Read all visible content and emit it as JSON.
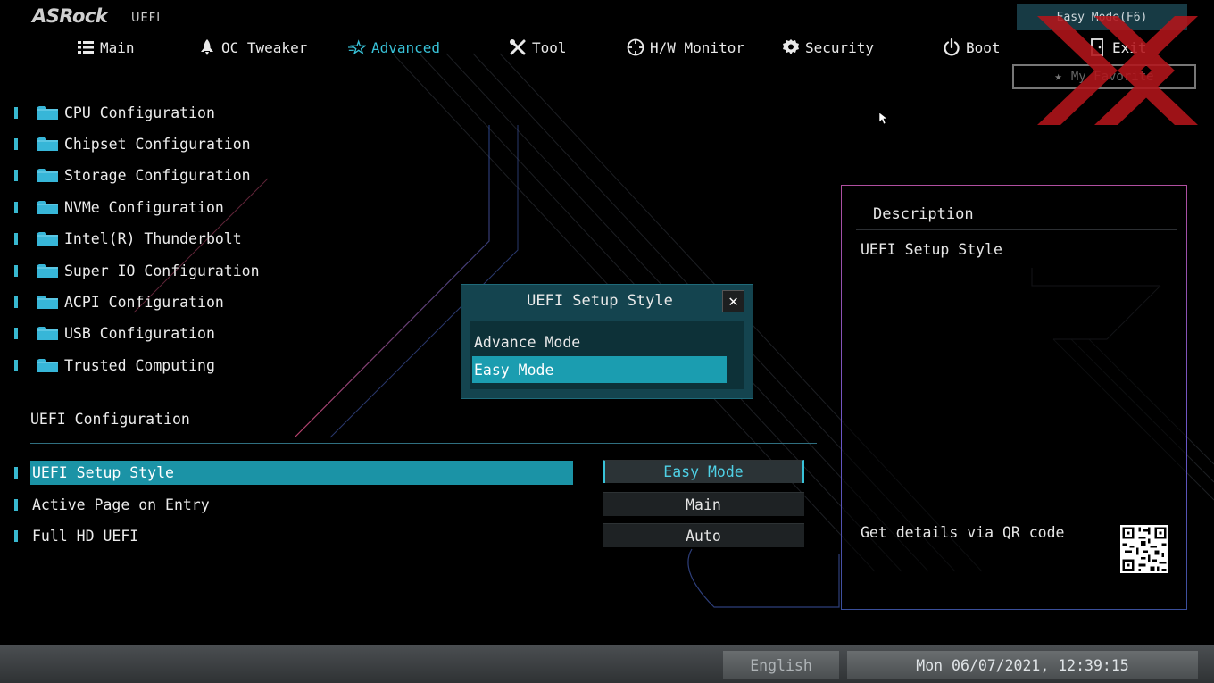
{
  "brand": {
    "logo": "ASRock",
    "suffix": "UEFI"
  },
  "nav": {
    "tabs": [
      {
        "label": "Main",
        "icon": "list-icon"
      },
      {
        "label": "OC Tweaker",
        "icon": "rocket-icon"
      },
      {
        "label": "Advanced",
        "icon": "star-icon",
        "active": true
      },
      {
        "label": "Tool",
        "icon": "tools-icon"
      },
      {
        "label": "H/W Monitor",
        "icon": "monitor-icon"
      },
      {
        "label": "Security",
        "icon": "shield-icon"
      },
      {
        "label": "Boot",
        "icon": "power-icon"
      },
      {
        "label": "Exit",
        "icon": "exit-door-icon"
      }
    ],
    "easy_mode_label": "Easy Mode(F6)",
    "favorite_label": "My Favorite"
  },
  "menu": {
    "items": [
      "CPU Configuration",
      "Chipset Configuration",
      "Storage Configuration",
      "NVMe Configuration",
      "Intel(R) Thunderbolt",
      "Super IO Configuration",
      "ACPI Configuration",
      "USB Configuration",
      "Trusted Computing"
    ]
  },
  "section": {
    "title": "UEFI Configuration",
    "options": [
      {
        "label": "UEFI Setup Style",
        "value": "Easy Mode",
        "selected": true
      },
      {
        "label": "Active Page on Entry",
        "value": "Main"
      },
      {
        "label": "Full HD UEFI",
        "value": "Auto"
      }
    ]
  },
  "popup": {
    "title": "UEFI Setup Style",
    "options": [
      {
        "label": "Advance Mode"
      },
      {
        "label": "Easy Mode",
        "selected": true
      }
    ]
  },
  "description": {
    "title": "Description",
    "text": "UEFI Setup Style",
    "qr_text": "Get details via QR code"
  },
  "status": {
    "language": "English",
    "datetime": "Mon 06/07/2021, 12:39:15"
  },
  "colors": {
    "accent": "#38c3d9",
    "selection": "#1b93a6",
    "popup_bg": "#14444f"
  }
}
